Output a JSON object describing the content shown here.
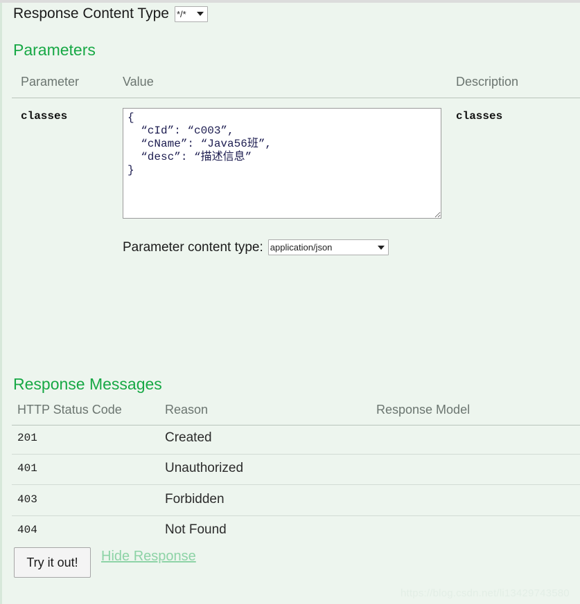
{
  "response_content_type": {
    "label": "Response Content Type",
    "selected": "*/*",
    "options": [
      "*/*"
    ]
  },
  "parameters_section": {
    "heading": "Parameters",
    "columns": {
      "parameter": "Parameter",
      "value": "Value",
      "description": "Description"
    },
    "rows": [
      {
        "name": "classes",
        "value": "{\n  “cId”: “c003”,\n  “cName”: “Java56班”,\n  “desc”: “描述信息”\n}",
        "description": "classes"
      }
    ],
    "parameter_content_type": {
      "label": "Parameter content type:",
      "selected": "application/json",
      "options": [
        "application/json"
      ]
    }
  },
  "response_messages_section": {
    "heading": "Response Messages",
    "columns": {
      "status_code": "HTTP Status Code",
      "reason": "Reason",
      "response_model": "Response Model"
    },
    "rows": [
      {
        "code": "201",
        "reason": "Created",
        "model": ""
      },
      {
        "code": "401",
        "reason": "Unauthorized",
        "model": ""
      },
      {
        "code": "403",
        "reason": "Forbidden",
        "model": ""
      },
      {
        "code": "404",
        "reason": "Not Found",
        "model": ""
      }
    ]
  },
  "footer": {
    "try_it_out_label": "Try it out!",
    "hide_response_label": "Hide Response"
  },
  "watermark": "https://blog.csdn.net/li13429743580",
  "colors": {
    "background": "#edf5ee",
    "heading_green": "#17a845",
    "link_green": "#8dd3a6",
    "json_text": "#1b1b4f",
    "divider": "#b9c4bb"
  }
}
